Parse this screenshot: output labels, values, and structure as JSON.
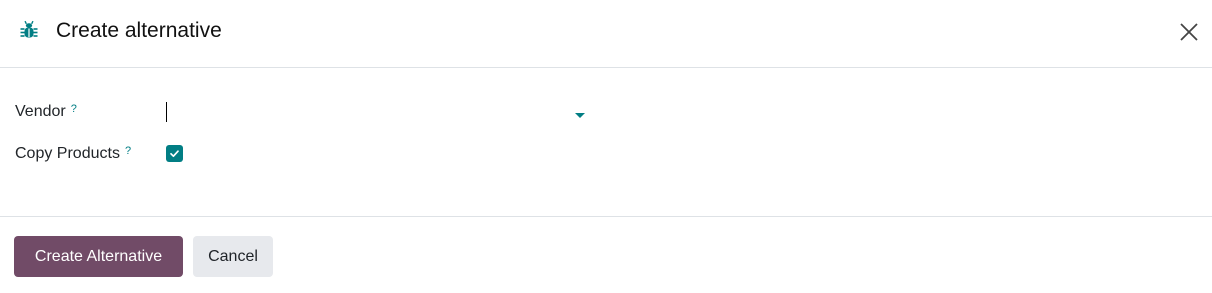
{
  "dialog": {
    "title": "Create alternative",
    "title_icon": "bug-icon",
    "close_icon": "close-icon"
  },
  "form": {
    "vendor": {
      "label": "Vendor",
      "help_marker": "?",
      "value": ""
    },
    "copy_products": {
      "label": "Copy Products",
      "help_marker": "?",
      "checked": true
    }
  },
  "footer": {
    "primary_label": "Create Alternative",
    "secondary_label": "Cancel"
  },
  "colors": {
    "primary": "#714b67",
    "accent": "#017e84",
    "secondary_bg": "#e7e9ed"
  }
}
